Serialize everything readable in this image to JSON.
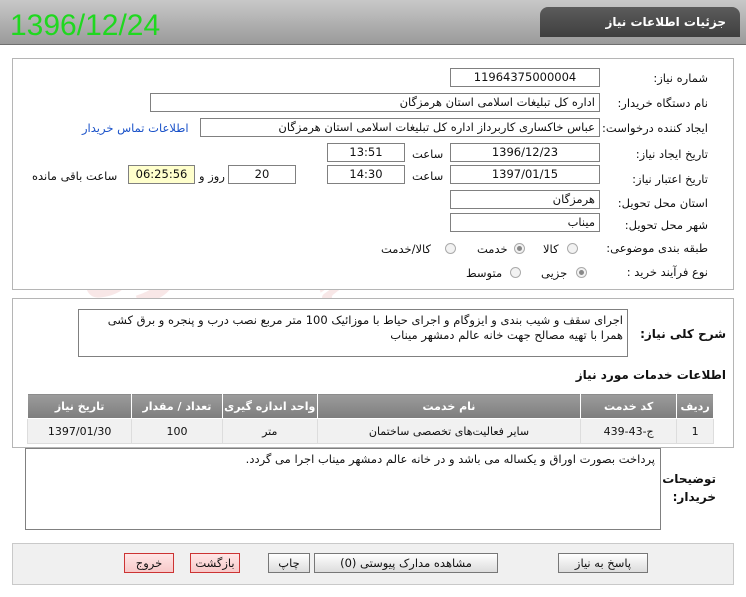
{
  "header": {
    "title": "جزئیات اطلاعات نیاز",
    "date": "1396/12/24"
  },
  "form": {
    "need_number_label": "شماره نیاز:",
    "need_number": "11964375000004",
    "buyer_label": "نام دستگاه خریدار:",
    "buyer": "اداره کل تبلیغات اسلامی استان هرمزگان",
    "requester_label": "ایجاد کننده درخواست:",
    "requester": "عباس  خاکساری  کاربرداز اداره کل تبلیغات اسلامی استان هرمزگان",
    "contact_link": "اطلاعات تماس خریدار",
    "created_label": "تاریخ ایجاد نیاز:",
    "created_date": "1396/12/23",
    "time_label": "ساعت",
    "created_time": "13:51",
    "deadline_label": "تاریخ اعتبار نیاز:",
    "deadline_date": "1397/01/15",
    "deadline_time": "14:30",
    "day_label": "روز و",
    "days": "20",
    "remaining": "06:25:56",
    "remaining_label": "ساعت باقی مانده",
    "province_label": "استان محل تحویل:",
    "province": "هرمزگان",
    "city_label": "شهر محل تحویل:",
    "city": "میناب",
    "category_label": "طبقه بندی موضوعی:",
    "cat_goods": "کالا",
    "cat_service": "خدمت",
    "cat_goods_service": "کالا/خدمت",
    "process_label": "نوع فرآیند خرید :",
    "proc_partial": "جزیی",
    "proc_medium": "متوسط"
  },
  "description": {
    "label": "شرح کلی نیاز:",
    "text": "اجرای سقف و شیب بندی و ایزوگام و اجرای حیاط با موزائیک   100 متر مربع نصب درب و پنجره و برق کشی همرا با تهیه مصالح جهت خانه عالم دمشهر میناب"
  },
  "services": {
    "title": "اطلاعات خدمات مورد نیاز",
    "headers": [
      "ردیف",
      "کد خدمت",
      "نام خدمت",
      "واحد اندازه گیری",
      "تعداد / مقدار",
      "تاریخ نیاز"
    ],
    "rows": [
      [
        "1",
        "ج-43-439",
        "سایر فعالیت‌های تخصصی ساختمان",
        "متر",
        "100",
        "1397/01/30"
      ]
    ]
  },
  "buyer_notes": {
    "label_line1": "توضیحات",
    "label_line2": "خریدار:",
    "text": "پرداخت بصورت اوراق و یکساله می باشد و در خانه عالم دمشهر میناب اجرا می گردد."
  },
  "buttons": {
    "reply": "پاسخ به نیاز",
    "attachments": "مشاهده مدارک پیوستی (0)",
    "print": "چاپ",
    "back": "بازگشت",
    "exit": "خروج"
  },
  "colors": {
    "date_green": "#1fd81f",
    "header_gray": "#4a4a4a",
    "yellow_field": "#ffffcc",
    "link_blue": "#1a52c9"
  }
}
